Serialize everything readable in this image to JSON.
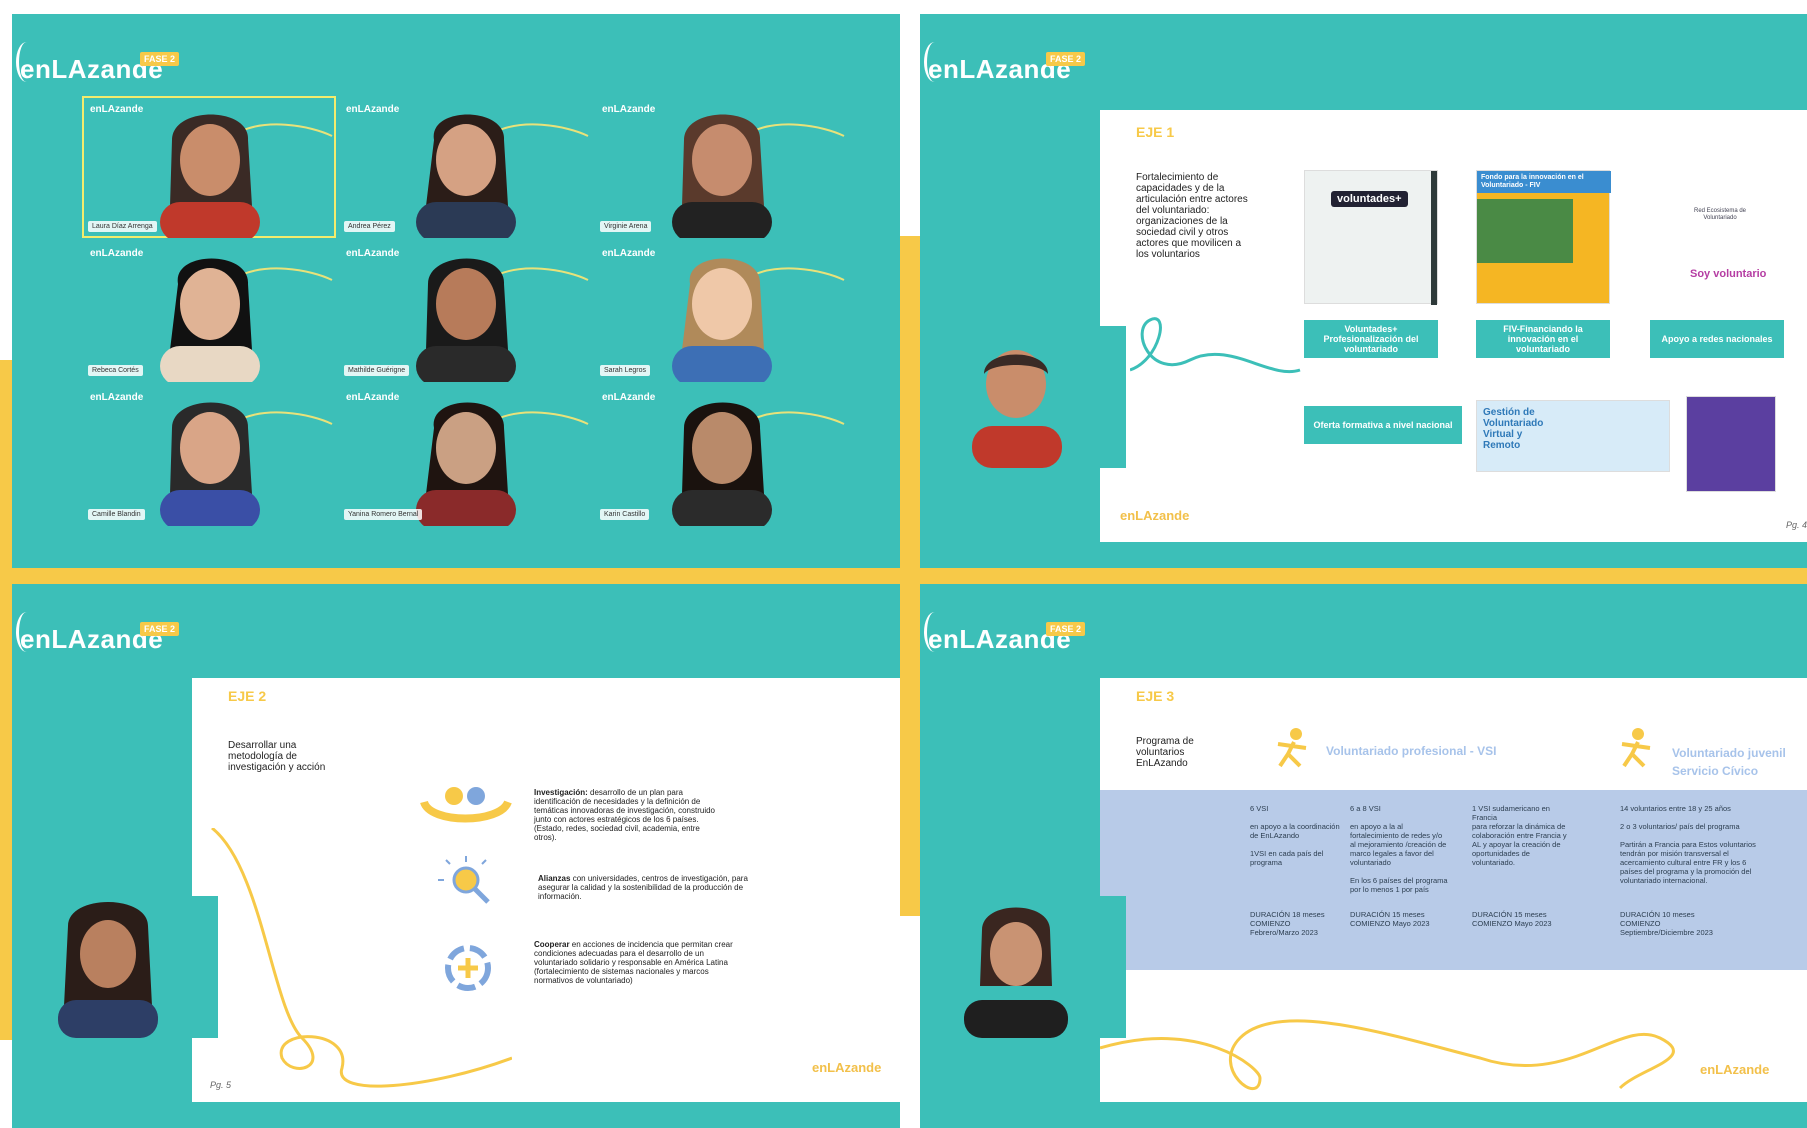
{
  "colors": {
    "teal": "#3cbfb8",
    "yellow": "#f7c948",
    "white": "#ffffff",
    "blue_zone": "#b8cbe8"
  },
  "brand": {
    "logo_text": "enLAzande",
    "badge": "FASE 2"
  },
  "panel1": {
    "participants": [
      {
        "name": "Laura Díaz Arrenga",
        "active": true
      },
      {
        "name": "Andrea Pérez",
        "active": false
      },
      {
        "name": "Virginie Arena",
        "active": false
      },
      {
        "name": "Rebeca Cortés",
        "active": false
      },
      {
        "name": "Mathilde Guérigne",
        "active": false
      },
      {
        "name": "Sarah Legros",
        "active": false
      },
      {
        "name": "Camille Blandin",
        "active": false
      },
      {
        "name": "Yanina Romero Bernal",
        "active": false
      },
      {
        "name": "Karin Castillo",
        "active": false
      }
    ]
  },
  "panel2": {
    "eje": "EJE 1",
    "description": "Fortalecimiento de capacidades y de la articulación entre actores del voluntariado: organizaciones de la sociedad civil y otros actores que movilicen a los voluntarios",
    "thumb1_title": "voluntades+",
    "thumb2_title": "Fondo para la innovación en el Voluntariado - FIV",
    "thumb3_title": "Red Ecosistema de Voluntariado",
    "thumb4_title": "Soy voluntario",
    "thumb5_title": "Gestión de Voluntariado Virtual y Remoto",
    "cards": [
      "Voluntades+ Profesionalización del voluntariado",
      "FIV-Financiando la innovación en el voluntariado",
      "Apoyo a redes nacionales",
      "Oferta formativa a nivel nacional"
    ],
    "page": "Pg. 4"
  },
  "panel3": {
    "eje": "EJE 2",
    "description": "Desarrollar una metodología de investigación y acción",
    "items": [
      {
        "bold": "Investigación:",
        "text": " desarrollo de un plan para identificación de necesidades y la definición de temáticas innovadoras de investigación, construido junto con actores estratégicos de los 6 países. (Estado, redes, sociedad civil, academia, entre otros)."
      },
      {
        "bold": "Alianzas",
        "text": " con universidades, centros de investigación, para asegurar la calidad y la sostenibilidad de la producción de información."
      },
      {
        "bold": "Cooperar",
        "text": " en acciones de incidencia que permitan crear condiciones adecuadas para el desarrollo de un voluntariado solidario y responsable en América Latina (fortalecimiento de sistemas nacionales y marcos normativos de voluntariado)"
      }
    ],
    "page": "Pg. 5"
  },
  "panel4": {
    "eje": "EJE 3",
    "description": "Programa de voluntarios EnLAzando",
    "program1": "Voluntariado profesional - VSI",
    "program2": "Voluntariado juvenil Servicio Cívico",
    "columns": [
      {
        "head": "6 VSI",
        "body": "en apoyo a la coordinación de EnLAzando\n\n1VSI en cada país del programa",
        "dur": "DURACIÓN  18 meses\nCOMIENZO\nFebrero/Marzo 2023"
      },
      {
        "head": "6 a 8 VSI",
        "body": "en apoyo a la al fortalecimiento de redes y/o al mejoramiento /creación de marco legales a favor del voluntariado\n\nEn los 6 países del programa por lo menos 1 por país",
        "dur": "DURACIÓN  15 meses\nCOMIENZO  Mayo 2023"
      },
      {
        "head": "1 VSI sudamericano en Francia",
        "body": "para reforzar la dinámica de colaboración entre Francia y AL y apoyar la creación de oportunidades de voluntariado.",
        "dur": "DURACIÓN  15 meses\nCOMIENZO  Mayo 2023"
      },
      {
        "head": "14 voluntarios entre 18 y 25 años",
        "body": "2 o 3 voluntarios/ país del programa\n\nPartirán a Francia para Estos voluntarios tendrán por misión transversal el acercamiento cultural entre FR y los 6 países del programa y la promoción del voluntariado internacional.",
        "dur": "DURACIÓN  10 meses\nCOMIENZO\nSeptiembre/Diciembre 2023"
      }
    ]
  }
}
